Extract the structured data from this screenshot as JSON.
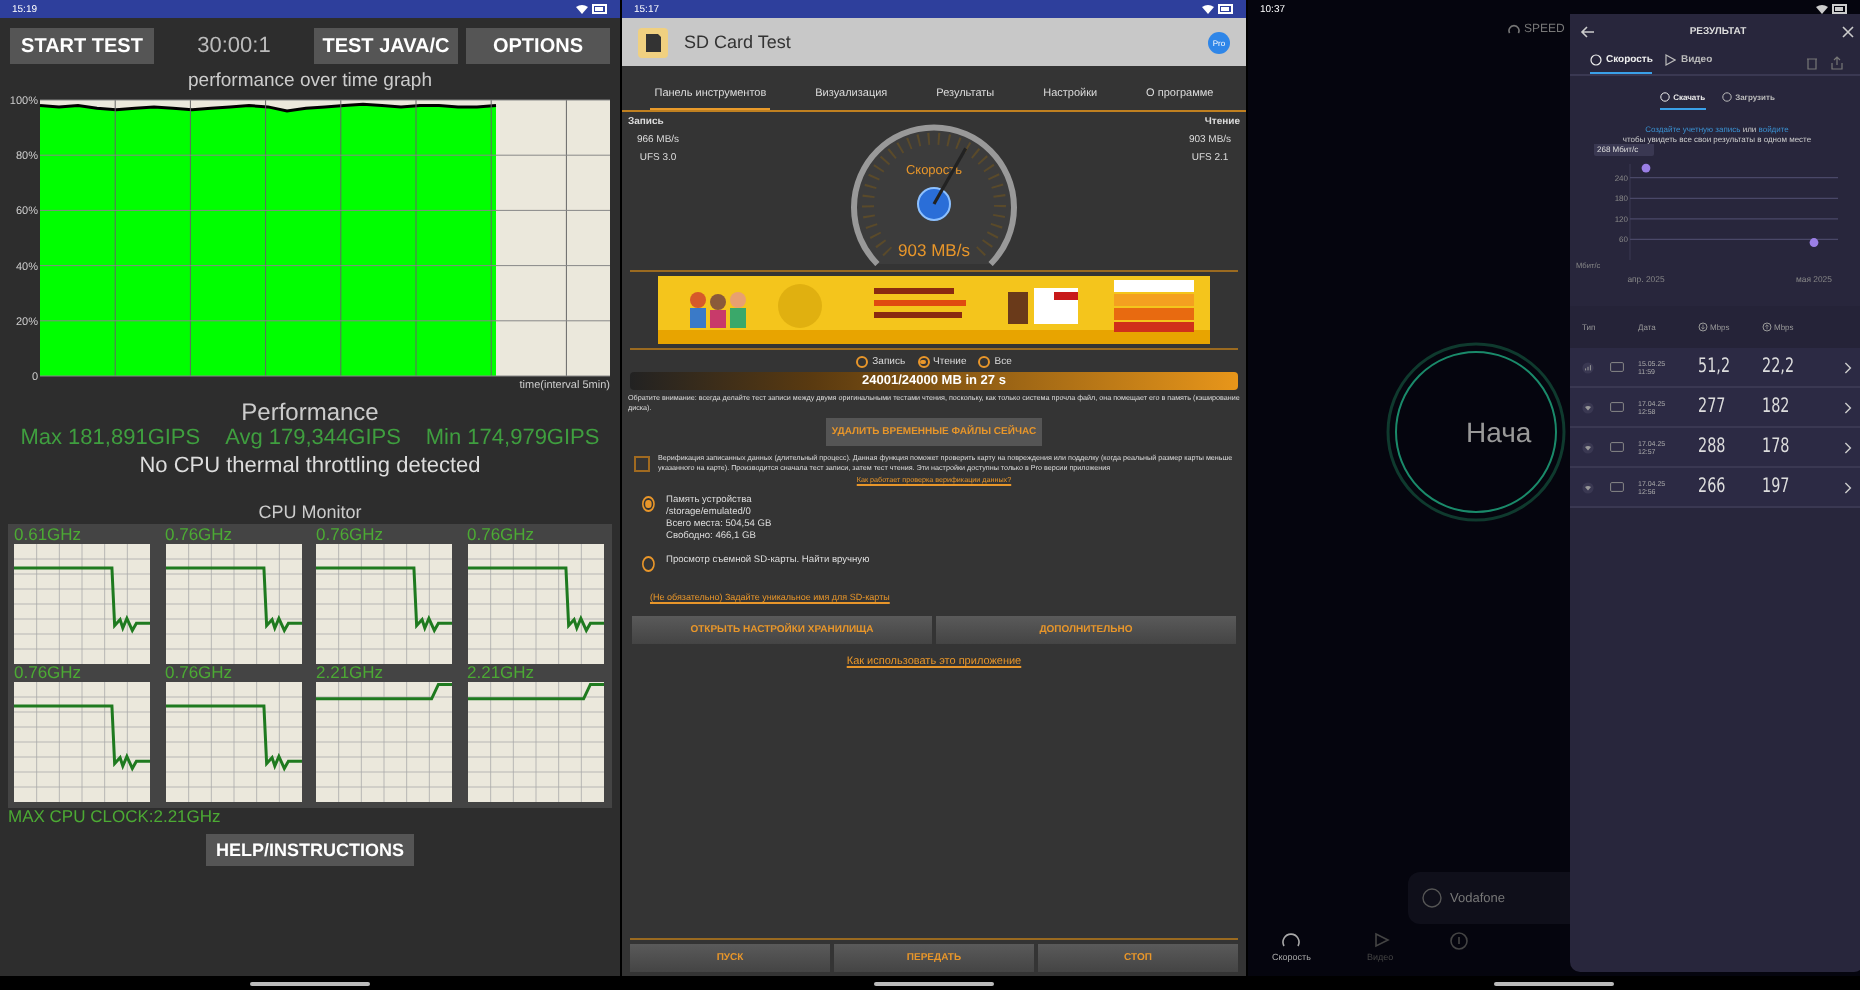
{
  "cpu_test": {
    "status_bar": {
      "time": "15:19"
    },
    "toolbar": [
      {
        "kind": "button",
        "label": "START TEST"
      },
      {
        "kind": "timer",
        "label": "30:00:1"
      },
      {
        "kind": "button",
        "label": "TEST JAVA/C"
      },
      {
        "kind": "button",
        "label": "OPTIONS"
      }
    ],
    "chart_data": {
      "type": "area",
      "title": "performance over time graph",
      "xlabel": "time(interval 5min)",
      "categories": [
        null,
        null,
        null,
        null,
        null,
        null,
        null,
        null,
        null,
        null,
        null,
        null,
        null,
        null,
        null,
        null,
        null,
        null,
        null,
        null,
        null,
        null,
        null,
        null,
        null,
        null,
        null,
        null,
        null,
        null,
        null
      ],
      "ylim": [
        0,
        100
      ],
      "grid": true,
      "yticks": [
        {
          "value": 0,
          "label": "0"
        },
        {
          "value": 20,
          "label": "20%"
        },
        {
          "value": 40,
          "label": "40%"
        },
        {
          "value": 60,
          "label": "60%"
        },
        {
          "value": 80,
          "label": "80%"
        },
        {
          "value": 100,
          "label": "100%"
        }
      ],
      "series": [
        {
          "color": "#00ff00",
          "values": [
            98,
            97.5,
            98,
            97,
            96.5,
            97,
            97.5,
            97,
            96.5,
            97,
            97.5,
            98,
            97.5,
            96,
            97,
            97.5,
            98,
            98.5,
            98,
            97.5,
            98,
            98,
            97.5,
            97.5,
            98,
            null,
            null,
            null,
            null,
            null,
            null
          ]
        }
      ]
    },
    "performance": {
      "heading": "Performance",
      "stats": [
        "Max 181,891GIPS",
        "Avg 179,344GIPS",
        "Min 174,979GIPS"
      ],
      "message": "No CPU thermal throttling detected"
    },
    "cpu_monitor": {
      "title": "CPU Monitor",
      "cores": [
        {
          "clock": "0.61GHz",
          "kind": "drop"
        },
        {
          "clock": "0.76GHz",
          "kind": "drop"
        },
        {
          "clock": "0.76GHz",
          "kind": "drop"
        },
        {
          "clock": "0.76GHz",
          "kind": "drop"
        },
        {
          "clock": "0.76GHz",
          "kind": "drop"
        },
        {
          "clock": "0.76GHz",
          "kind": "drop"
        },
        {
          "clock": "2.21GHz",
          "kind": "rise"
        },
        {
          "clock": "2.21GHz",
          "kind": "rise"
        }
      ],
      "max_clock": "MAX CPU CLOCK:2.21GHz"
    },
    "help_button": "HELP/INSTRUCTIONS"
  },
  "sd_card_test": {
    "status_bar": {
      "time": "15:17"
    },
    "app_bar": {
      "title": "SD Card Test",
      "badge": "Pro"
    },
    "tabs": [
      {
        "label": "Панель инструментов",
        "selected": true
      },
      {
        "label": "Визуализация",
        "selected": false
      },
      {
        "label": "Результаты",
        "selected": false
      },
      {
        "label": "Настройки",
        "selected": false
      },
      {
        "label": "О программе",
        "selected": false
      }
    ],
    "write": {
      "label": "Запись",
      "speed": "966 MB/s",
      "interface": "UFS 3.0"
    },
    "read": {
      "label": "Чтение",
      "speed": "903 MB/s",
      "interface": "UFS 2.1"
    },
    "gauge": {
      "label": "Скорость",
      "reading": "903 MB/s",
      "level": 0.61
    },
    "ad": {
      "kind": "picture"
    },
    "modes": [
      {
        "label": "Запись",
        "selected": false
      },
      {
        "label": "Чтение",
        "selected": true
      },
      {
        "label": "Все",
        "selected": false
      }
    ],
    "progress": {
      "text": "24001/24000 MB in 27 s",
      "level": 1
    },
    "note": "Обратите внимание: всегда делайте тест записи между двумя оригинальными тестами чтения, поскольку, как только система прочла файл, она помещает его в память (кэширование диска).",
    "delete_button": "УДАЛИТЬ ВРЕМЕННЫЕ ФАЙЛЫ СЕЙЧАС",
    "verify": {
      "checked": false,
      "text": "Верификация записанных данных (длительный процесс). Данная функция поможет проверить карту на повреждения или подделку (когда реальный размер карты меньше указанного на карте). Производится сначала тест записи, затем тест чтения. Эти настройки доступны только в Pro версии приложения",
      "link": "Как работает проверка верификации данных?"
    },
    "storage": [
      {
        "selected": true,
        "lines": [
          "Память устройства",
          "/storage/emulated/0",
          "Всего места: 504,54 GB",
          "Свободно: 466,1 GB"
        ]
      },
      {
        "selected": false,
        "lines": [
          "Просмотр съемной SD-карты. Найти вручную"
        ]
      }
    ],
    "name_link": "(Не обязательно) Задайте уникальное имя для SD-карты",
    "buttons": [
      "ОТКРЫТЬ НАСТРОЙКИ ХРАНИЛИЩА",
      "ДОПОЛНИТЕЛЬНО"
    ],
    "howto_link": "Как использовать это приложение",
    "bottom_buttons": [
      "ПУСК",
      "ПЕРЕДАТЬ",
      "СТОП"
    ]
  },
  "speed_test": {
    "status_bar": {
      "time": "10:37"
    },
    "logo": "SPEED",
    "start": "Нача",
    "provider": "Vodafone",
    "nav": [
      {
        "label": "Скорость",
        "selected": true
      },
      {
        "label": "Видео",
        "selected": false
      }
    ],
    "result": {
      "title": "РЕЗУЛЬТАТ",
      "tabs": [
        {
          "label": "Скорость",
          "selected": true
        },
        {
          "label": "Видео",
          "selected": false
        }
      ],
      "subtabs": [
        {
          "label": "Скачать",
          "selected": true
        },
        {
          "label": "Загрузить",
          "selected": false
        }
      ],
      "prompt": {
        "create_link": "Создайте учетную запись",
        "middle": "или",
        "login_link": "войдите",
        "text": "чтобы увидеть все свои результаты в одном месте"
      },
      "chart_unit": "Мбит/с",
      "chart_data": {
        "type": "scatter",
        "categories": [
          "апр. 2025",
          "мая 2025"
        ],
        "ylim": [
          0,
          280
        ],
        "yticks": [
          60,
          120,
          180,
          240
        ],
        "grid": "y",
        "series": [
          {
            "color": "#9b7fe6",
            "values": [
              268,
              51
            ]
          }
        ],
        "annotations": [
          {
            "x": "апр. 2025",
            "y": 268,
            "text": "268 Мбит/с"
          }
        ]
      },
      "columns": [
        "Тип",
        "Дата",
        "Mbps",
        "Mbps"
      ],
      "rows": [
        {
          "kind": "cellular",
          "date": "15.05.25",
          "time": "11:59",
          "download": "51,2",
          "upload": "22,2"
        },
        {
          "kind": "wifi",
          "date": "17.04.25",
          "time": "12:58",
          "download": "277",
          "upload": "182"
        },
        {
          "kind": "wifi",
          "date": "17.04.25",
          "time": "12:57",
          "download": "288",
          "upload": "178"
        },
        {
          "kind": "wifi",
          "date": "17.04.25",
          "time": "12:56",
          "download": "266",
          "upload": "197"
        }
      ]
    }
  }
}
